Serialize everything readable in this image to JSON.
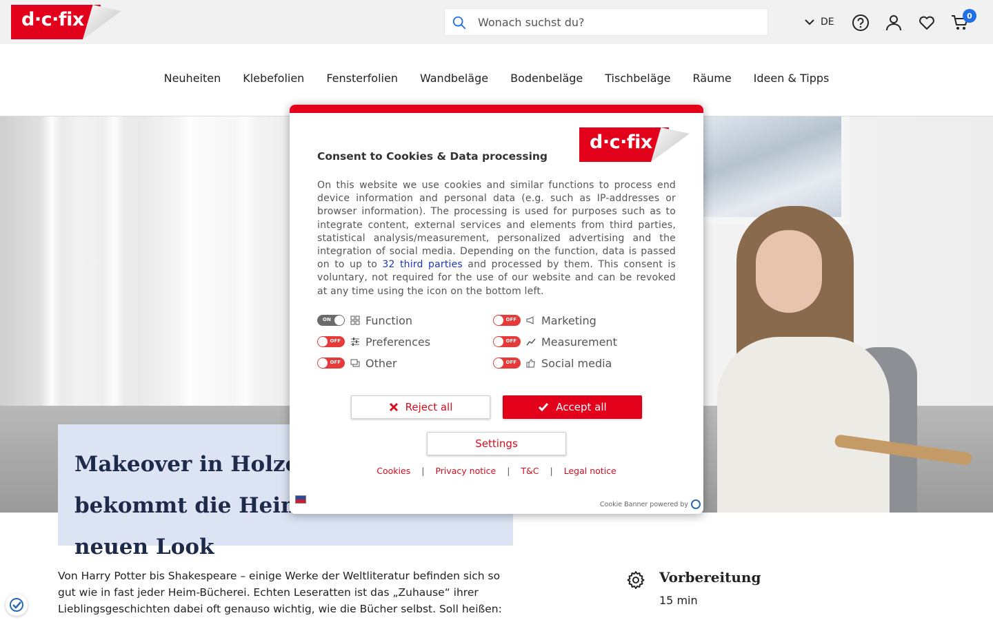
{
  "header": {
    "logo_text": "d·c·fix",
    "search_placeholder": "Wonach suchst du?",
    "language": "DE",
    "cart_count": "0"
  },
  "nav": {
    "items": [
      "Neuheiten",
      "Klebefolien",
      "Fensterfolien",
      "Wandbeläge",
      "Bodenbeläge",
      "Tischbeläge",
      "Räume",
      "Ideen & Tipps"
    ]
  },
  "article": {
    "title": "Makeover in Holzoptik: So bekommt die Heim-Bücherei einen neuen Look",
    "intro": "Von Harry Potter bis Shakespeare – einige Werke der Weltliteratur befinden sich so gut wie in fast jeder Heim-Bücherei. Echten Leseratten ist das „Zuhause“ ihrer Lieblingsgeschichten dabei oft genauso wichtig, wie die Bücher selbst. Soll heißen: Die",
    "prep_label": "Vorbereitung",
    "prep_time": "15 min"
  },
  "cookie_modal": {
    "title": "Consent to Cookies & Data processing",
    "logo_text": "d·c·fix",
    "text_before_link": "On this website we use cookies and similar functions to process end device information and personal data (e.g. such as IP-addresses or browser information). The processing is used for purposes such as to integrate content, external services and elements from third parties, statistical analysis/measurement, personalized advertising and the integration of social media. Depending on the function, data is passed on to up to ",
    "link_text": "32 third parties",
    "text_after_link": " and processed by them. This consent is voluntary, not required for the use of our website and can be revoked at any time using the icon on the bottom left.",
    "options": {
      "function": {
        "label": "Function",
        "state": "ON"
      },
      "marketing": {
        "label": "Marketing",
        "state": "OFF"
      },
      "preferences": {
        "label": "Preferences",
        "state": "OFF"
      },
      "measurement": {
        "label": "Measurement",
        "state": "OFF"
      },
      "other": {
        "label": "Other",
        "state": "OFF"
      },
      "social": {
        "label": "Social media",
        "state": "OFF"
      }
    },
    "reject_label": "Reject all",
    "accept_label": "Accept all",
    "settings_label": "Settings",
    "links": {
      "cookies": "Cookies",
      "privacy": "Privacy notice",
      "tc": "T&C",
      "legal": "Legal notice",
      "sep": "|"
    },
    "powered_by": "Cookie Banner powered by"
  },
  "colors": {
    "brand_red": "#e3001b",
    "cart_badge": "#1e6fe8",
    "title_box": "#dce4f4",
    "link_blue": "#1a34b8"
  }
}
